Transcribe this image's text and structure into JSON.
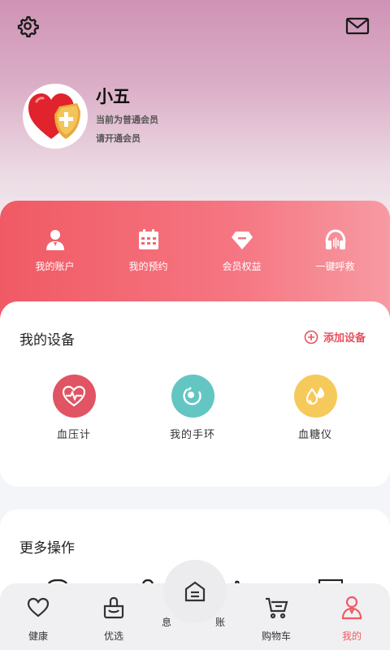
{
  "header": {
    "settings_icon": "gear-icon",
    "mail_icon": "mail-icon"
  },
  "profile": {
    "name": "小五",
    "status": "当前为普通会员",
    "open_member": "请开通会员",
    "avatar_icon": "heart-shield-icon"
  },
  "quick_actions": [
    {
      "label": "我的账户",
      "icon": "user-icon"
    },
    {
      "label": "我的预约",
      "icon": "calendar-icon"
    },
    {
      "label": "会员权益",
      "icon": "diamond-icon"
    },
    {
      "label": "一键呼救",
      "icon": "headset-icon"
    }
  ],
  "devices": {
    "title": "我的设备",
    "add_label": "添加设备",
    "items": [
      {
        "label": "血压计",
        "icon": "heart-pulse-icon",
        "color": "#e05463"
      },
      {
        "label": "我的手环",
        "icon": "band-icon",
        "color": "#63c6c3"
      },
      {
        "label": "血糖仪",
        "icon": "drops-icon",
        "color": "#f6c95b"
      }
    ]
  },
  "more": {
    "title": "更多操作"
  },
  "tabbar": {
    "items": [
      {
        "label": "健康",
        "icon": "heart-outline-icon"
      },
      {
        "label": "优选",
        "icon": "basket-icon"
      },
      {
        "label": "购物车",
        "icon": "cart-icon"
      },
      {
        "label": "我的",
        "icon": "person-outline-icon"
      }
    ],
    "partial_left": "息",
    "partial_right": "账",
    "center_icon": "home-icon",
    "active_color": "#ef5a63"
  }
}
